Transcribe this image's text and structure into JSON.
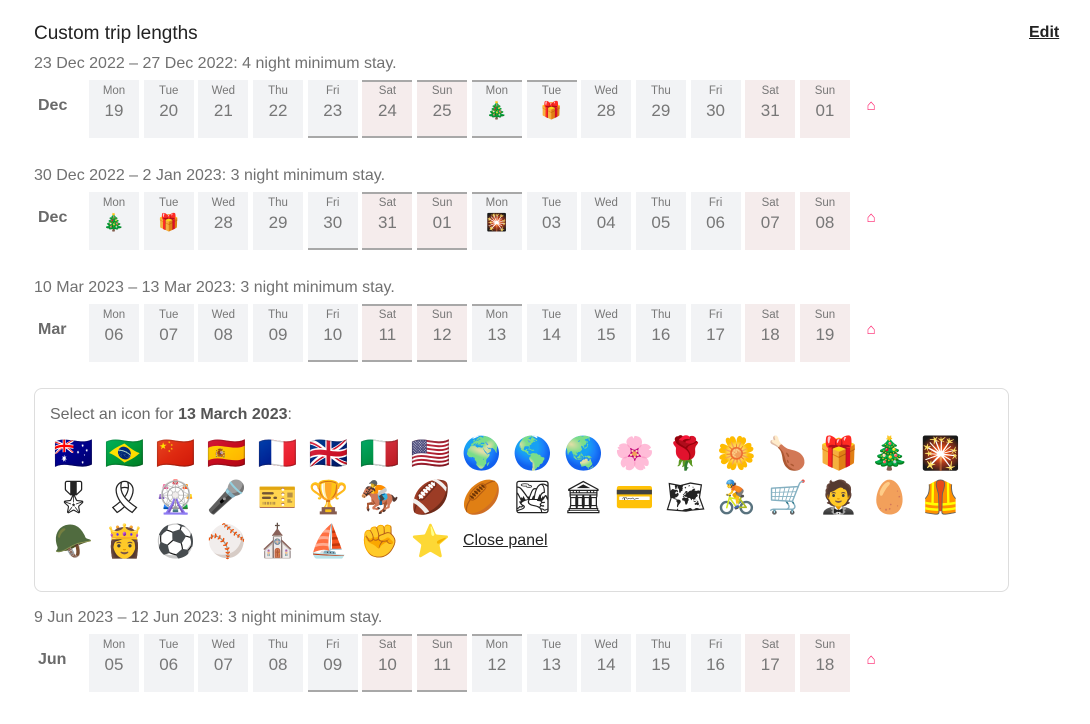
{
  "header": {
    "title": "Custom trip lengths",
    "edit_label": "Edit"
  },
  "accent": "#ff1f6b",
  "sections": [
    {
      "label": "23 Dec 2022 – 27 Dec 2022: 4 night minimum stay.",
      "month": "Dec",
      "days": [
        {
          "dow": "Mon",
          "day": "19"
        },
        {
          "dow": "Tue",
          "day": "20"
        },
        {
          "dow": "Wed",
          "day": "21"
        },
        {
          "dow": "Thu",
          "day": "22"
        },
        {
          "dow": "Fri",
          "day": "23",
          "range": "end"
        },
        {
          "dow": "Sat",
          "day": "24",
          "weekend": true,
          "range": "both"
        },
        {
          "dow": "Sun",
          "day": "25",
          "weekend": true,
          "range": "both"
        },
        {
          "dow": "Mon",
          "day": "🎄",
          "range": "both",
          "icon": "christmas-tree"
        },
        {
          "dow": "Tue",
          "day": "🎁",
          "range": "start",
          "icon": "gift"
        },
        {
          "dow": "Wed",
          "day": "28"
        },
        {
          "dow": "Thu",
          "day": "29"
        },
        {
          "dow": "Fri",
          "day": "30"
        },
        {
          "dow": "Sat",
          "day": "31",
          "weekend": true
        },
        {
          "dow": "Sun",
          "day": "01",
          "weekend": true
        }
      ]
    },
    {
      "label": "30 Dec 2022 – 2 Jan 2023: 3 night minimum stay.",
      "month": "Dec",
      "days": [
        {
          "dow": "Mon",
          "day": "🎄",
          "icon": "christmas-tree"
        },
        {
          "dow": "Tue",
          "day": "🎁",
          "icon": "gift"
        },
        {
          "dow": "Wed",
          "day": "28"
        },
        {
          "dow": "Thu",
          "day": "29"
        },
        {
          "dow": "Fri",
          "day": "30",
          "range": "end"
        },
        {
          "dow": "Sat",
          "day": "31",
          "weekend": true,
          "range": "both"
        },
        {
          "dow": "Sun",
          "day": "01",
          "weekend": true,
          "range": "both"
        },
        {
          "dow": "Mon",
          "day": "🎇",
          "range": "start",
          "icon": "sparkler"
        },
        {
          "dow": "Tue",
          "day": "03"
        },
        {
          "dow": "Wed",
          "day": "04"
        },
        {
          "dow": "Thu",
          "day": "05"
        },
        {
          "dow": "Fri",
          "day": "06"
        },
        {
          "dow": "Sat",
          "day": "07",
          "weekend": true
        },
        {
          "dow": "Sun",
          "day": "08",
          "weekend": true
        }
      ]
    },
    {
      "label": "10 Mar 2023 – 13 Mar 2023: 3 night minimum stay.",
      "month": "Mar",
      "days": [
        {
          "dow": "Mon",
          "day": "06"
        },
        {
          "dow": "Tue",
          "day": "07"
        },
        {
          "dow": "Wed",
          "day": "08"
        },
        {
          "dow": "Thu",
          "day": "09"
        },
        {
          "dow": "Fri",
          "day": "10",
          "range": "end"
        },
        {
          "dow": "Sat",
          "day": "11",
          "weekend": true,
          "range": "both"
        },
        {
          "dow": "Sun",
          "day": "12",
          "weekend": true,
          "range": "both"
        },
        {
          "dow": "Mon",
          "day": "13",
          "range": "start"
        },
        {
          "dow": "Tue",
          "day": "14"
        },
        {
          "dow": "Wed",
          "day": "15"
        },
        {
          "dow": "Thu",
          "day": "16"
        },
        {
          "dow": "Fri",
          "day": "17"
        },
        {
          "dow": "Sat",
          "day": "18",
          "weekend": true
        },
        {
          "dow": "Sun",
          "day": "19",
          "weekend": true
        }
      ]
    },
    {
      "label": "9 Jun 2023 – 12 Jun 2023: 3 night minimum stay.",
      "month": "Jun",
      "days": [
        {
          "dow": "Mon",
          "day": "05"
        },
        {
          "dow": "Tue",
          "day": "06"
        },
        {
          "dow": "Wed",
          "day": "07"
        },
        {
          "dow": "Thu",
          "day": "08"
        },
        {
          "dow": "Fri",
          "day": "09",
          "range": "end"
        },
        {
          "dow": "Sat",
          "day": "10",
          "weekend": true,
          "range": "both"
        },
        {
          "dow": "Sun",
          "day": "11",
          "weekend": true,
          "range": "both"
        },
        {
          "dow": "Mon",
          "day": "12",
          "range": "start"
        },
        {
          "dow": "Tue",
          "day": "13"
        },
        {
          "dow": "Wed",
          "day": "14"
        },
        {
          "dow": "Thu",
          "day": "15"
        },
        {
          "dow": "Fri",
          "day": "16"
        },
        {
          "dow": "Sat",
          "day": "17",
          "weekend": true
        },
        {
          "dow": "Sun",
          "day": "18",
          "weekend": true
        }
      ]
    }
  ],
  "panel": {
    "prefix": "Select an icon for ",
    "date": "13 March 2023",
    "suffix": ":",
    "close_label": "Close panel",
    "icons": [
      {
        "name": "flag-australia",
        "glyph": "🇦🇺"
      },
      {
        "name": "flag-brazil",
        "glyph": "🇧🇷"
      },
      {
        "name": "flag-china",
        "glyph": "🇨🇳"
      },
      {
        "name": "flag-spain",
        "glyph": "🇪🇸"
      },
      {
        "name": "flag-france",
        "glyph": "🇫🇷"
      },
      {
        "name": "flag-uk",
        "glyph": "🇬🇧"
      },
      {
        "name": "flag-italy",
        "glyph": "🇮🇹"
      },
      {
        "name": "flag-usa",
        "glyph": "🇺🇸"
      },
      {
        "name": "globe-europe-africa",
        "glyph": "🌍"
      },
      {
        "name": "globe-americas",
        "glyph": "🌎"
      },
      {
        "name": "globe-asia",
        "glyph": "🌏"
      },
      {
        "name": "cherry-blossom",
        "glyph": "🌸"
      },
      {
        "name": "rose",
        "glyph": "🌹"
      },
      {
        "name": "blossom",
        "glyph": "🌼"
      },
      {
        "name": "drumstick",
        "glyph": "🍗"
      },
      {
        "name": "gift",
        "glyph": "🎁"
      },
      {
        "name": "christmas-tree",
        "glyph": "🎄"
      },
      {
        "name": "sparkler",
        "glyph": "🎇"
      },
      {
        "name": "military-medal",
        "glyph": "🎖"
      },
      {
        "name": "ribbon",
        "glyph": "🎗"
      },
      {
        "name": "ferris-wheel",
        "glyph": "🎡"
      },
      {
        "name": "microphone",
        "glyph": "🎤"
      },
      {
        "name": "ticket",
        "glyph": "🎫"
      },
      {
        "name": "trophy",
        "glyph": "🏆"
      },
      {
        "name": "horse-racing",
        "glyph": "🏇"
      },
      {
        "name": "american-football",
        "glyph": "🏈"
      },
      {
        "name": "rugby-football",
        "glyph": "🏉"
      },
      {
        "name": "national-park",
        "glyph": "🏞"
      },
      {
        "name": "classical-building",
        "glyph": "🏛"
      },
      {
        "name": "credit-card",
        "glyph": "💳"
      },
      {
        "name": "world-map",
        "glyph": "🗺"
      },
      {
        "name": "bicyclist",
        "glyph": "🚴"
      },
      {
        "name": "shopping-cart",
        "glyph": "🛒"
      },
      {
        "name": "person",
        "glyph": "🤵"
      },
      {
        "name": "egg",
        "glyph": "🥚"
      },
      {
        "name": "safety-vest",
        "glyph": "🦺"
      },
      {
        "name": "military-helmet",
        "glyph": "🪖"
      },
      {
        "name": "princess",
        "glyph": "👸"
      },
      {
        "name": "soccer-ball",
        "glyph": "⚽"
      },
      {
        "name": "baseball",
        "glyph": "⚾"
      },
      {
        "name": "church",
        "glyph": "⛪"
      },
      {
        "name": "sailboat",
        "glyph": "⛵"
      },
      {
        "name": "raised-fist",
        "glyph": "✊"
      },
      {
        "name": "star",
        "glyph": "⭐"
      }
    ]
  }
}
